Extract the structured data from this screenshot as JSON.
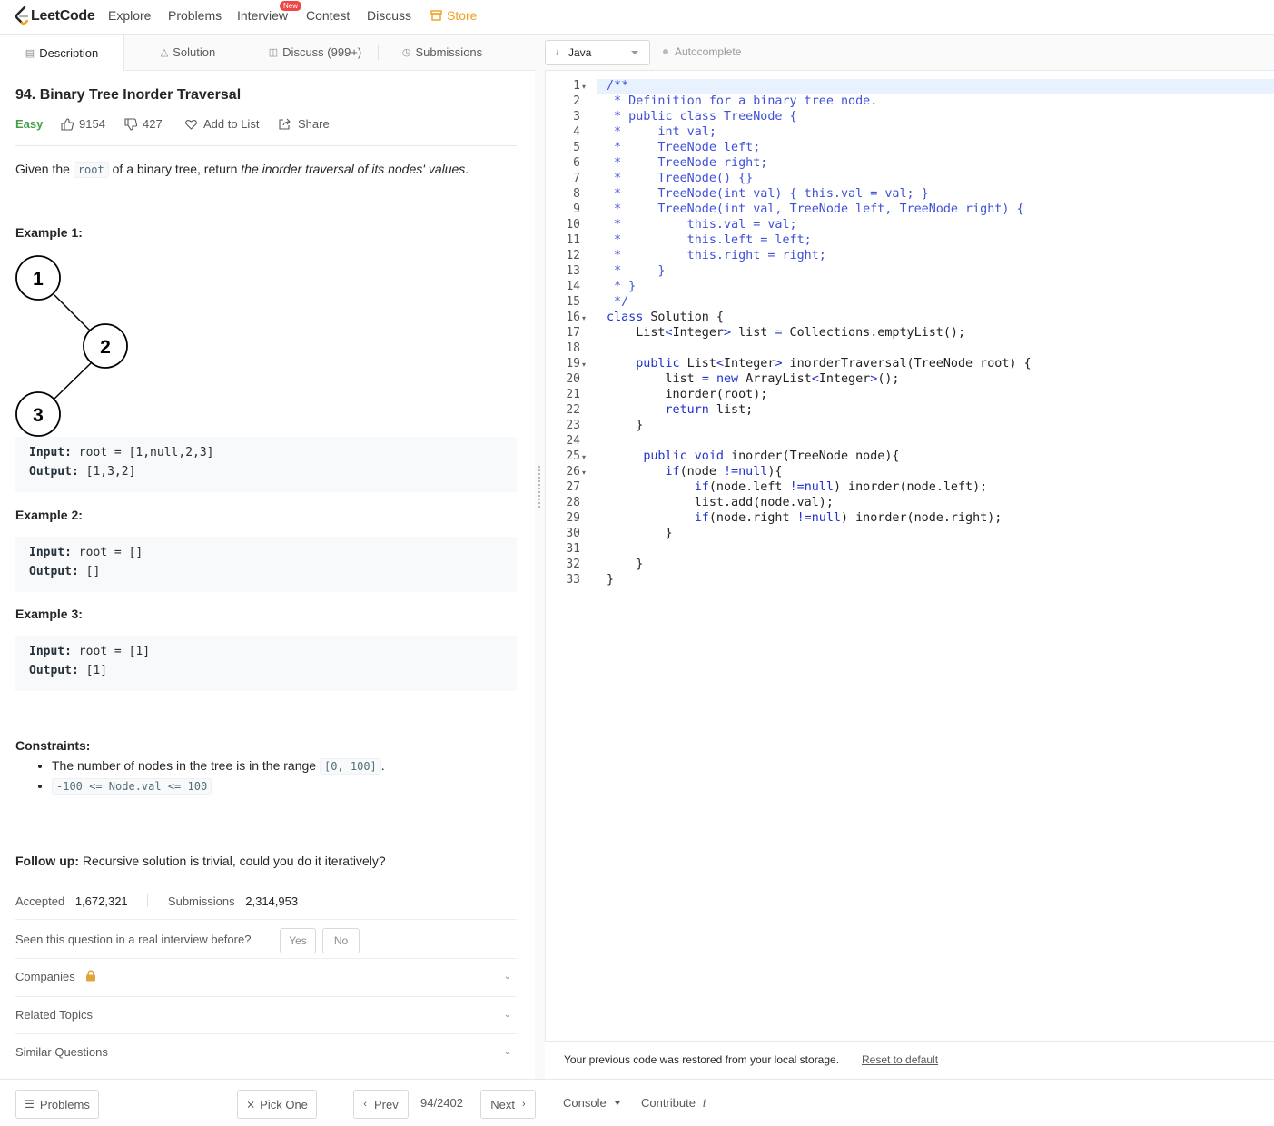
{
  "nav": {
    "logo": "LeetCode",
    "links": [
      "Explore",
      "Problems",
      "Interview",
      "Contest",
      "Discuss"
    ],
    "new_badge": "New",
    "store": "Store"
  },
  "tabs": {
    "description": "Description",
    "solution": "Solution",
    "discuss": "Discuss (999+)",
    "submissions": "Submissions"
  },
  "problem": {
    "title": "94. Binary Tree Inorder Traversal",
    "difficulty": "Easy",
    "likes": "9154",
    "dislikes": "427",
    "add_to_list": "Add to List",
    "share": "Share",
    "desc_pre": "Given the ",
    "desc_code": "root",
    "desc_mid": " of a binary tree, return ",
    "desc_em": "the inorder traversal of its nodes' values",
    "desc_end": ".",
    "tree_nodes": [
      "1",
      "2",
      "3"
    ],
    "examples": [
      {
        "heading": "Example 1:",
        "input_label": "Input:",
        "input": " root = [1,null,2,3]",
        "output_label": "Output:",
        "output": " [1,3,2]"
      },
      {
        "heading": "Example 2:",
        "input_label": "Input:",
        "input": " root = []",
        "output_label": "Output:",
        "output": " []"
      },
      {
        "heading": "Example 3:",
        "input_label": "Input:",
        "input": " root = [1]",
        "output_label": "Output:",
        "output": " [1]"
      }
    ],
    "constraints_heading": "Constraints:",
    "constraint1_text": "The number of nodes in the tree is in the range ",
    "constraint1_code": "[0, 100]",
    "constraint1_end": ".",
    "constraint2_code": "-100 <= Node.val <= 100",
    "followup_label": "Follow up:",
    "followup_text": " Recursive solution is trivial, could you do it iteratively?",
    "accepted_label": "Accepted",
    "accepted": "1,672,321",
    "submissions_label": "Submissions",
    "submissions": "2,314,953",
    "interview_q": "Seen this question in a real interview before?",
    "yes": "Yes",
    "no": "No",
    "companies": "Companies",
    "related_topics": "Related Topics",
    "similar_questions": "Similar Questions"
  },
  "bottom": {
    "problems": "Problems",
    "pick_one": "Pick One",
    "prev": "Prev",
    "page": "94/2402",
    "next": "Next",
    "console": "Console",
    "contribute": "Contribute"
  },
  "editor": {
    "language": "Java",
    "autocomplete": "Autocomplete",
    "restore_msg": "Your previous code was restored from your local storage.",
    "reset": "Reset to default",
    "lines": [
      "/**",
      " * Definition for a binary tree node.",
      " * public class TreeNode {",
      " *     int val;",
      " *     TreeNode left;",
      " *     TreeNode right;",
      " *     TreeNode() {}",
      " *     TreeNode(int val) { this.val = val; }",
      " *     TreeNode(int val, TreeNode left, TreeNode right) {",
      " *         this.val = val;",
      " *         this.left = left;",
      " *         this.right = right;",
      " *     }",
      " * }",
      " */",
      "class Solution {",
      "    List<Integer> list = Collections.emptyList();",
      "",
      "    public List<Integer> inorderTraversal(TreeNode root) {",
      "        list = new ArrayList<Integer>();",
      "        inorder(root);",
      "        return list;",
      "    }",
      "",
      "     public void inorder(TreeNode node){",
      "        if(node !=null){",
      "            if(node.left !=null) inorder(node.left);",
      "            list.add(node.val);",
      "            if(node.right !=null) inorder(node.right);",
      "        }",
      "",
      "    }",
      "}"
    ],
    "fold_lines": [
      1,
      16,
      19,
      25,
      26
    ]
  }
}
